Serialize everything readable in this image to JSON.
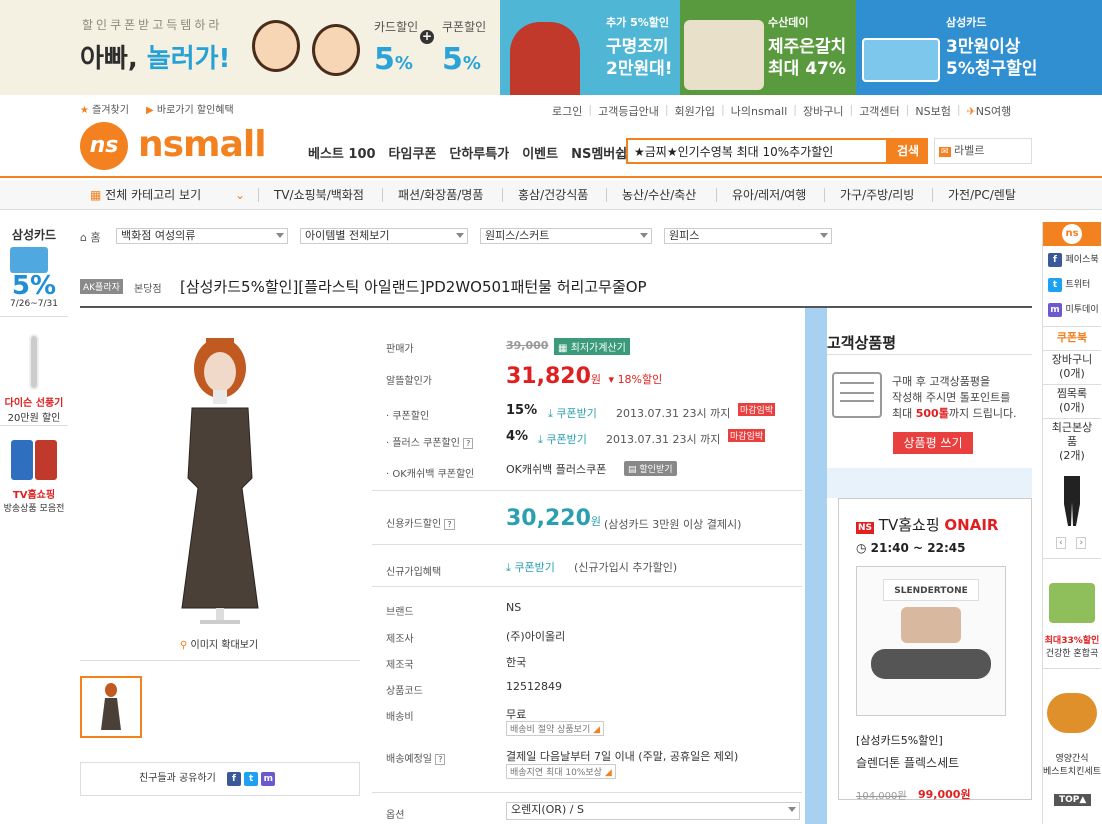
{
  "banner": {
    "tagline": "할인쿠폰받고득템하라",
    "slogan_a": "아빠, ",
    "slogan_b": "놀러가!",
    "card_label": "카드할인",
    "card_pct": "5",
    "coupon_label": "쿠폰할인",
    "coupon_pct": "5",
    "pct_unit": "%",
    "promo1_small": "추가 5%할인",
    "promo1_big1": "구명조끼",
    "promo1_big2": "2만원대!",
    "promo2_small": "수산데이",
    "promo2_big1": "제주은갈치",
    "promo2_big2": "최대 47%",
    "promo3_small": "삼성카드",
    "promo3_big1": "3만원이상",
    "promo3_big2": "5%청구할인"
  },
  "header": {
    "favorite": "즐겨찾기",
    "shortcut": "바로가기 할인혜택",
    "util_links": [
      "로그인",
      "고객등급안내",
      "회원가입",
      "나의nsmall",
      "장바구니",
      "고객센터",
      "NS보험",
      "NS여행"
    ],
    "logo_mark": "ns",
    "logo_text": "nsmall",
    "nav": [
      "베스트 100",
      "타임쿠폰",
      "단하루특가",
      "이벤트",
      "NS멤버쉽"
    ],
    "search_value": "★금찌★인기수영복 최대 10%추가할인",
    "search_button": "검색",
    "label_text": "라벨르"
  },
  "categories": {
    "all": "전체 카테고리 보기",
    "items": [
      "TV/쇼핑북/백화점",
      "패션/화장품/명품",
      "홍삼/건강식품",
      "농산/수산/축산",
      "유아/레저/여행",
      "가구/주방/리빙",
      "가전/PC/렌탈"
    ]
  },
  "left_side": {
    "card_title": "삼성카드",
    "card_pct": "5%",
    "card_period": "7/26~7/31",
    "fan_line1": "다이슨 선풍기",
    "fan_line2": "20만원 할인",
    "tv_line1": "TV홈쇼핑",
    "tv_line2": "방송상품 모음전"
  },
  "breadcrumb": {
    "home": "홈",
    "selects": [
      "백화점 여성의류",
      "아이템별 전체보기",
      "원피스/스커트",
      "원피스"
    ]
  },
  "product": {
    "brand_tag": "AK플라자",
    "store": "본당점",
    "title": "[삼성카드5%할인][플라스틱 아일랜드]PD2WO501패턴물 허리고무줄OP",
    "zoom": "이미지 확대보기",
    "share": "친구들과 공유하기",
    "price_label": "판매가",
    "price_orig": "39,000",
    "calc_btn": "최저가계산기",
    "sale_label": "알뜰할인가",
    "sale_price": "31,820",
    "won": "원",
    "sale_pct": "18%할인",
    "coupon1_label": "쿠폰할인",
    "coupon1_pct": "15%",
    "coupon_btn": "쿠폰받기",
    "coupon1_date": "2013.07.31 23시 까지",
    "deadline": "마감임박",
    "coupon2_label": "플러스 쿠폰할인",
    "coupon2_pct": "4%",
    "coupon2_date": "2013.07.31 23시 까지",
    "ok_label": "OK캐쉬백 쿠폰할인",
    "ok_text": "OK캐쉬백 플러스쿠폰",
    "ok_btn": "할인받기",
    "card_label": "신용카드할인",
    "card_price": "30,220",
    "card_note": "(삼성카드 3만원 이상 결제시)",
    "new_label": "신규가입혜택",
    "new_note": "(신규가입시 추가할인)",
    "brand_label": "브랜드",
    "brand_value": "NS",
    "maker_label": "제조사",
    "maker_value": "(주)아이올리",
    "origin_label": "제조국",
    "origin_value": "한국",
    "code_label": "상품코드",
    "code_value": "12512849",
    "ship_label": "배송비",
    "ship_value": "무료",
    "ship_note": "배송비 절약 상품보기",
    "eta_label": "배송예정일",
    "eta_value": "결제일 다음날부터 7일 이내 (주말, 공휴일은 제외)",
    "eta_note": "배송지연 최대 10%보상",
    "option_label": "옵션",
    "option_value": "오렌지(OR) / S"
  },
  "review": {
    "title": "고객상품평",
    "line1": "구매 후 고객상품평을",
    "line2": "작성해 주시면 톨포인트를",
    "line3a": "최대 ",
    "line3b": "500톨",
    "line3c": "까지 드립니다.",
    "button": "상품평 쓰기"
  },
  "tv": {
    "title": "TV홈쇼핑",
    "onair": "ONAIR",
    "time": "21:40 ~ 22:45",
    "product_brand": "SLENDERTONE",
    "tag": "[삼성카드5%할인]",
    "name": "슬렌더톤 플렉스세트",
    "orig": "104,000원",
    "price": "99,000원"
  },
  "right_bar": {
    "logo": "ns",
    "facebook": "페이스북",
    "twitter": "트위터",
    "me2day": "미투데이",
    "coupon": "쿠폰북",
    "cart": "장바구니",
    "cart_count": "(0개)",
    "wish": "찜목록",
    "wish_count": "(0개)",
    "recent": "최근본상품",
    "recent_count": "(2개)",
    "ad1_line1": "최대33%할인",
    "ad1_line2": "건강한 혼합곡",
    "ad2_line1": "영양간식",
    "ad2_line2": "베스트치킨세트",
    "top": "TOP"
  },
  "colors": {
    "brand_orange": "#f48120",
    "sale_red": "#e02020",
    "teal": "#2a9fb0"
  }
}
